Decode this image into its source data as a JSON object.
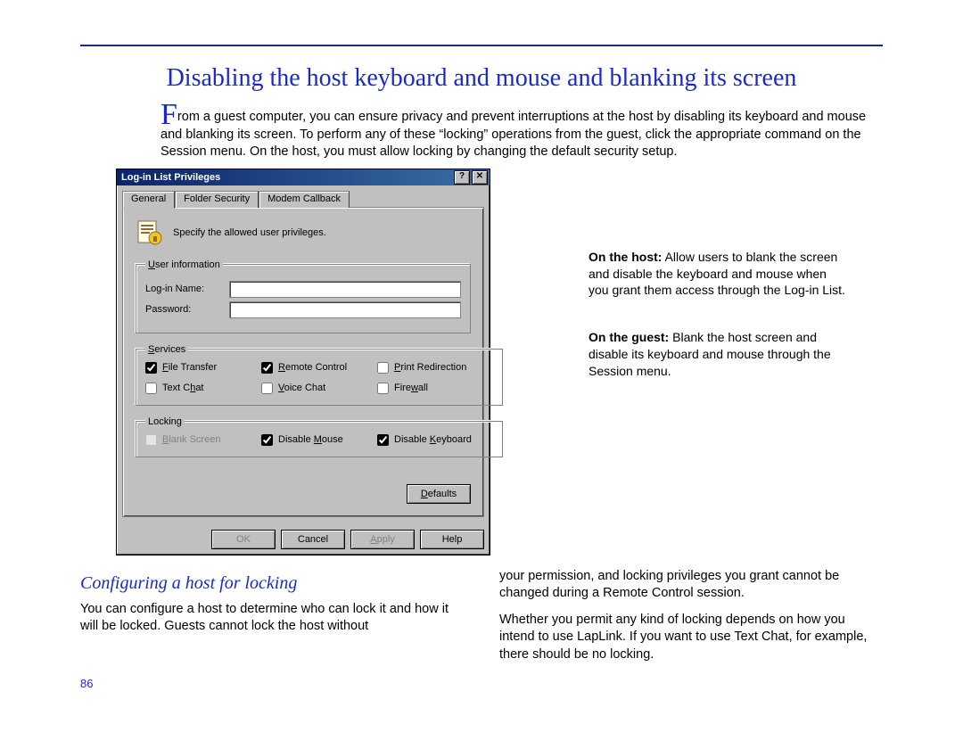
{
  "page_number": "86",
  "title": "Disabling the host keyboard and mouse and blanking its screen",
  "intro_first_letter": "F",
  "intro_rest": "rom a guest computer, you can ensure privacy and prevent interruptions at the host by disabling its keyboard and mouse and blanking its screen. To perform any of these “locking” operations from the guest, click the appropriate command on the Session menu. On the host, you must allow locking by changing the default security setup.",
  "annotations": {
    "host_bold": "On the host:",
    "host_text": " Allow users to blank the screen and disable the keyboard and mouse when you grant them access through the Log-in List.",
    "guest_bold": "On the guest:",
    "guest_text": " Blank the host screen and disable its keyboard and mouse through the Session menu."
  },
  "dialog": {
    "title": "Log-in List Privileges",
    "help_btn": "?",
    "close_btn": "✕",
    "tabs": [
      "General",
      "Folder Security",
      "Modem Callback"
    ],
    "active_tab": 0,
    "spec_text": "Specify the allowed user privileges.",
    "groups": {
      "user_info": {
        "legend": "User information",
        "login_label": "Log-in Name:",
        "password_label": "Password:",
        "login_value": "",
        "password_value": ""
      },
      "services": {
        "legend": "Services",
        "items": [
          {
            "label": "File Transfer",
            "checked": true,
            "enabled": true,
            "accel": "F"
          },
          {
            "label": "Remote Control",
            "checked": true,
            "enabled": true,
            "accel": "R"
          },
          {
            "label": "Print Redirection",
            "checked": false,
            "enabled": true,
            "accel": "P"
          },
          {
            "label": "Text Chat",
            "checked": false,
            "enabled": true,
            "accel": "h"
          },
          {
            "label": "Voice Chat",
            "checked": false,
            "enabled": true,
            "accel": "V"
          },
          {
            "label": "Firewall",
            "checked": false,
            "enabled": true,
            "accel": "w"
          }
        ]
      },
      "locking": {
        "legend": "Locking",
        "items": [
          {
            "label": "Blank Screen",
            "checked": false,
            "enabled": false,
            "accel": "B"
          },
          {
            "label": "Disable Mouse",
            "checked": true,
            "enabled": true,
            "accel": "M"
          },
          {
            "label": "Disable Keyboard",
            "checked": true,
            "enabled": true,
            "accel": "K"
          }
        ]
      }
    },
    "defaults_btn": "Defaults",
    "buttons": {
      "ok": "OK",
      "cancel": "Cancel",
      "apply": "Apply",
      "help": "Help"
    }
  },
  "columns": {
    "subhead": "Configuring a host for locking",
    "left_p1": "You can configure a host to determine who can lock it and how it will be locked. Guests cannot lock the host without",
    "right_p1": "your permission, and locking privileges you grant cannot be changed during a Remote Control session.",
    "right_p2": "Whether you permit any kind of locking depends on how you intend to use LapLink. If you want to use Text Chat, for example, there should be no locking."
  }
}
